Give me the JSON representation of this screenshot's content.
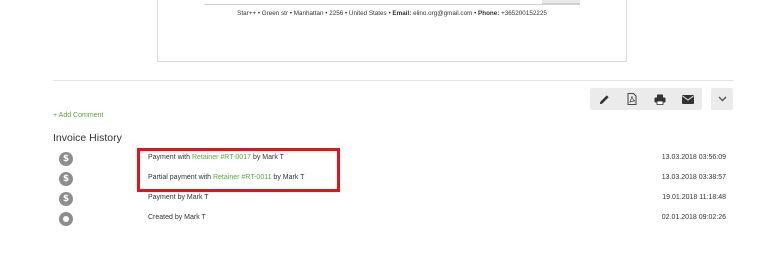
{
  "invoice_preview": {
    "footer": {
      "company": "Star++",
      "address": " • Green str • Manhattan • 2256 • United States • ",
      "email_label": "Email:",
      "email_value": " elino.org@gmail.com • ",
      "phone_label": "Phone:",
      "phone_value": " +365200152225"
    }
  },
  "toolbar": {
    "buttons": [
      {
        "name": "edit-icon"
      },
      {
        "name": "pdf-icon"
      },
      {
        "name": "print-icon"
      },
      {
        "name": "email-icon"
      }
    ],
    "more": {
      "name": "chevron-down-icon"
    }
  },
  "add_comment_label": "+ Add Comment",
  "history": {
    "title": "Invoice History",
    "rows": [
      {
        "icon": "dollar-icon",
        "prefix": "Payment with ",
        "link": "Retainer #RT-0017",
        "suffix": " by Mark T",
        "date": "13.03.2018 03:56:09"
      },
      {
        "icon": "dollar-icon",
        "prefix": "Partial payment with ",
        "link": "Retainer #RT-0011",
        "suffix": " by Mark T",
        "date": "13.03.2018 03:38:57"
      },
      {
        "icon": "dollar-icon",
        "prefix": "Payment by Mark T",
        "link": "",
        "suffix": "",
        "date": "19.01.2018 11:18:48"
      },
      {
        "icon": "created-icon",
        "prefix": "Created by Mark T",
        "link": "",
        "suffix": "",
        "date": "02.01.2018 09:02:26"
      }
    ]
  },
  "colors": {
    "link": "#5aa63b",
    "highlight": "#e0141e",
    "icon_gray": "#8d8d8d"
  }
}
